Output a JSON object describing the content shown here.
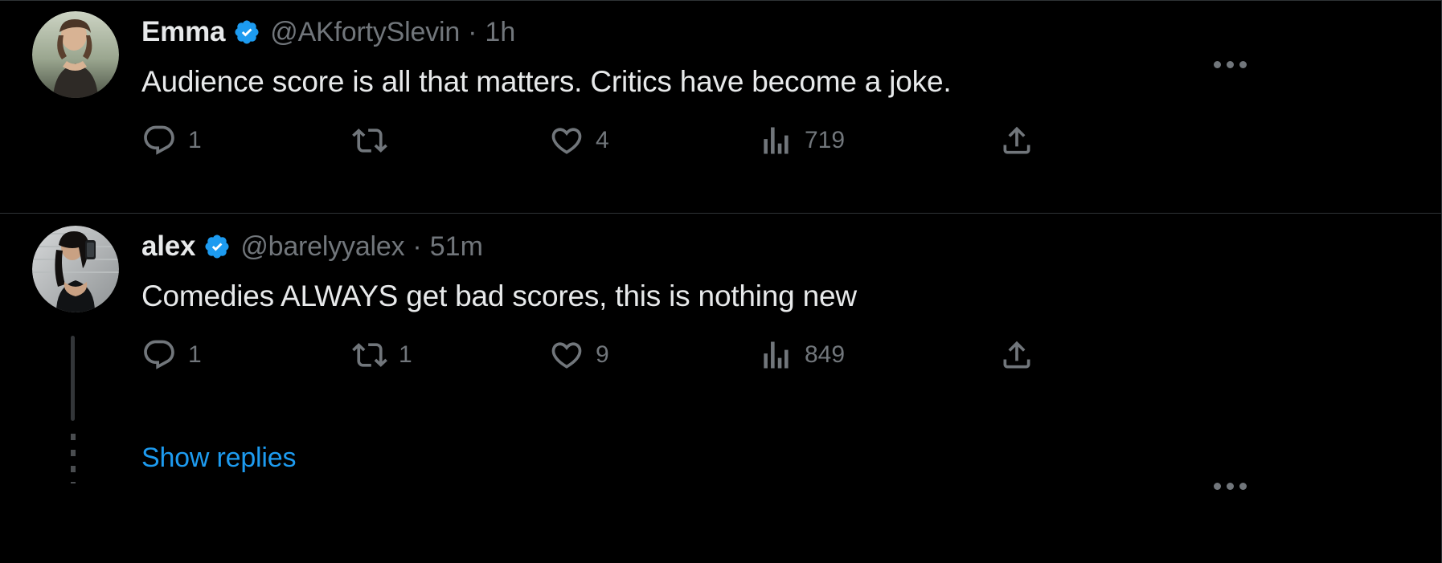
{
  "app": {
    "name": "X / Twitter thread",
    "theme": "dark",
    "colors": {
      "background": "#000000",
      "text_primary": "#e7e9ea",
      "text_secondary": "#71767b",
      "accent_link": "#1d9bf0",
      "verified_badge": "#1d9bf0",
      "divider": "#2f3336",
      "thread_line": "#333639"
    }
  },
  "tweets": [
    {
      "display_name": "Emma",
      "verified": true,
      "handle": "@AKfortySlevin",
      "separator": "·",
      "timestamp": "1h",
      "text": "Audience score is all that matters. Critics have become a joke.",
      "actions": {
        "reply_count": "1",
        "retweet_count": "",
        "like_count": "4",
        "views_count": "719",
        "share_label": ""
      },
      "more_menu": "…"
    },
    {
      "display_name": "alex",
      "verified": true,
      "handle": "@barelyyalex",
      "separator": "·",
      "timestamp": "51m",
      "text": "Comedies ALWAYS get bad scores, this is nothing new",
      "actions": {
        "reply_count": "1",
        "retweet_count": "1",
        "like_count": "9",
        "views_count": "849",
        "share_label": ""
      },
      "more_menu": "…"
    }
  ],
  "show_replies": {
    "label": "Show replies"
  },
  "icons": {
    "reply": "reply-icon",
    "retweet": "retweet-icon",
    "like": "heart-icon",
    "views": "analytics-bar-chart-icon",
    "share": "share-upload-icon",
    "verified": "verified-badge-icon",
    "more": "more-options-icon"
  }
}
